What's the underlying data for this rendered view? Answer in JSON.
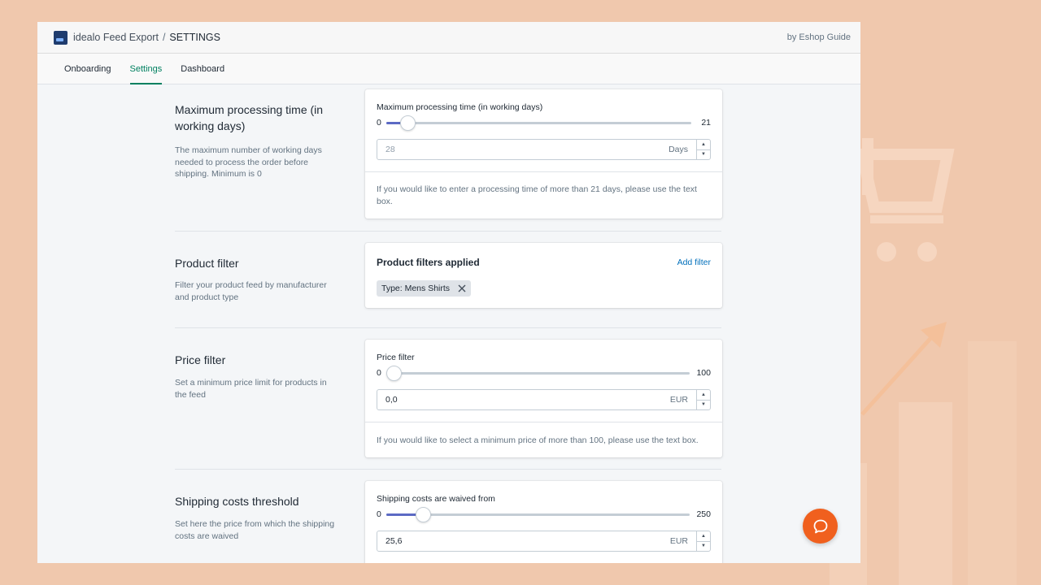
{
  "header": {
    "app_name": "idealo Feed Export",
    "separator": "/",
    "page_name": "SETTINGS",
    "by_line": "by Eshop Guide"
  },
  "tabs": [
    {
      "label": "Onboarding",
      "active": false
    },
    {
      "label": "Settings",
      "active": true
    },
    {
      "label": "Dashboard",
      "active": false
    }
  ],
  "sections": {
    "processing": {
      "title": "Maximum processing time (in working days)",
      "description": "The maximum number of working days needed to process the order before shipping. Minimum is 0",
      "field_label": "Maximum processing time (in working days)",
      "slider_min": "0",
      "slider_max": "21",
      "slider_fraction": 0.07,
      "input_placeholder": "28",
      "input_suffix": "Days",
      "help": "If you would like to enter a processing time of more than 21 days, please use the text box."
    },
    "product_filter": {
      "title": "Product filter",
      "description": "Filter your product feed by manufacturer and product type",
      "heading": "Product filters applied",
      "add_label": "Add filter",
      "tags": [
        "Type: Mens Shirts"
      ]
    },
    "price_filter": {
      "title": "Price filter",
      "description": "Set a minimum price limit for products in the feed",
      "field_label": "Price filter",
      "slider_min": "0",
      "slider_max": "100",
      "slider_fraction": 0.0,
      "input_value": "0,0",
      "input_suffix": "EUR",
      "help": "If you would like to select a minimum price of more than 100, please use the text box."
    },
    "shipping": {
      "title": "Shipping costs threshold",
      "description": "Set here the price from which the shipping costs are waived",
      "field_label": "Shipping costs are waived from",
      "slider_min": "0",
      "slider_max": "250",
      "slider_fraction": 0.12,
      "input_value": "25,6",
      "input_suffix": "EUR"
    }
  },
  "icons": {
    "app_logo": "idealo-logo-icon",
    "tag_remove": "close-icon",
    "chat": "chat-bubble-icon",
    "step_up": "caret-up-icon",
    "step_down": "caret-down-icon"
  },
  "colors": {
    "accent_green": "#008060",
    "slider_fill": "#5c6ac4",
    "link_blue": "#006fbb",
    "chat_orange": "#f0601e",
    "background_peach": "#f0c8ad"
  }
}
